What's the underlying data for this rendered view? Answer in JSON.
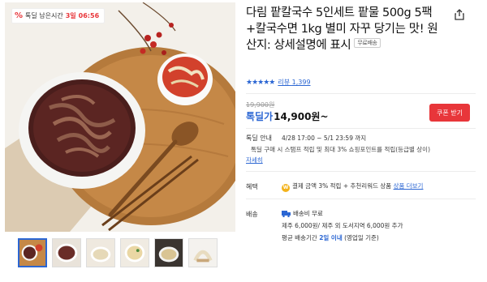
{
  "deal_badge": {
    "icon": "percent-icon",
    "label": "톡딜 남은시간",
    "days": "3일",
    "time": "06:56"
  },
  "product": {
    "title": "다림 팥칼국수 5인세트 팥물 500g 5팩+칼국수면 1kg 별미 자꾸 당기는 맛! 원산지: 상세설명에 표시",
    "shipping_tag": "무료배송"
  },
  "rating": {
    "stars": "★★★★★",
    "reviews_label": "리뷰",
    "reviews_count": "1,399"
  },
  "price": {
    "original": "19,900원",
    "sale_label": "톡딜가",
    "sale_price": "14,900원~",
    "coupon_button": "쿠폰 받기"
  },
  "talkdeal": {
    "label": "톡딜 안내",
    "period": "4/28 17:00 ~ 5/1 23:59 까지",
    "desc": "톡딜 구매 시 스탬프 적립 및 최대 3% 쇼핑포인트를 적립(등급별 상이)",
    "more": "자세히"
  },
  "benefit": {
    "label": "혜택",
    "text": "결제 금액 3% 적립 + 추천리워드 상품",
    "link": "상품 더보기"
  },
  "shipping": {
    "label": "배송",
    "fee": "배송비 무료",
    "region_fee": "제주 6,000원/ 제주 외 도서지역 6,000원 추가",
    "avg_prefix": "평균 배송기간",
    "avg_days": "2일 이내",
    "avg_suffix": "(영업일 기준)"
  },
  "thumbnails": [
    "thumb-1",
    "thumb-2",
    "thumb-3",
    "thumb-4",
    "thumb-5",
    "thumb-6"
  ],
  "colors": {
    "accent_blue": "#2b66d3",
    "coupon_red": "#e8363a"
  }
}
